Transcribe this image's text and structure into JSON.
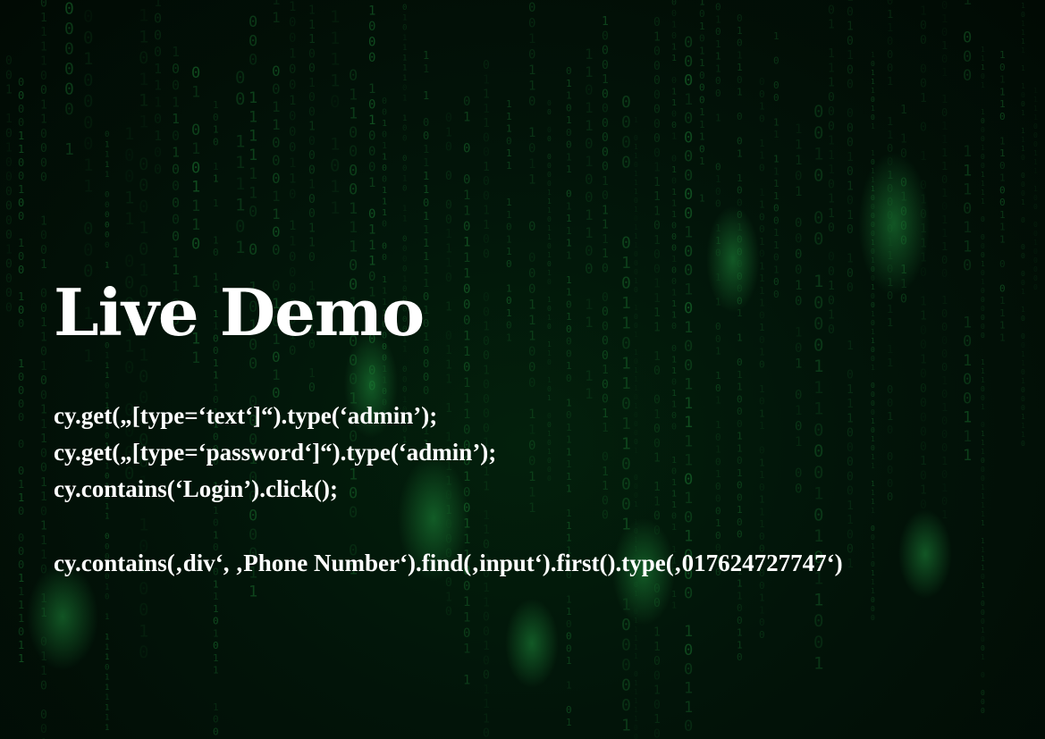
{
  "slide": {
    "title": "Live Demo",
    "code_lines": [
      "cy.get(„[type=‘text‘]“).type(‘admin’);",
      "cy.get(„[type=‘password‘]“).type(‘admin’);",
      "cy.contains(‘Login’).click();",
      "cy.contains(‚div‘, ‚Phone Number‘).find(‚input‘).first().type(‚017624727747‘)"
    ]
  },
  "background": {
    "style": "matrix-binary-rain",
    "glyphs": [
      "0",
      "1"
    ],
    "base_color": "#021006",
    "glyph_color": "#1c7a32",
    "glow_color": "#2fd45a"
  }
}
